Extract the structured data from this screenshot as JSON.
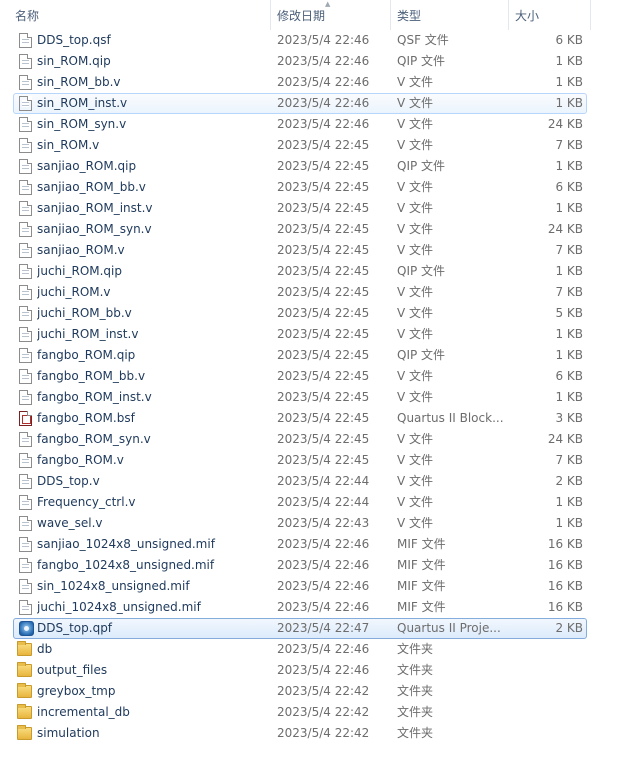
{
  "columns": {
    "name": "名称",
    "date": "修改日期",
    "type": "类型",
    "size": "大小"
  },
  "files": [
    {
      "name": "DDS_top.qsf",
      "date": "2023/5/4 22:46",
      "type": "QSF 文件",
      "size": "6 KB",
      "icon": "document-icon"
    },
    {
      "name": "sin_ROM.qip",
      "date": "2023/5/4 22:46",
      "type": "QIP 文件",
      "size": "1 KB",
      "icon": "document-icon"
    },
    {
      "name": "sin_ROM_bb.v",
      "date": "2023/5/4 22:46",
      "type": "V 文件",
      "size": "1 KB",
      "icon": "document-icon"
    },
    {
      "name": "sin_ROM_inst.v",
      "date": "2023/5/4 22:46",
      "type": "V 文件",
      "size": "1 KB",
      "icon": "document-icon",
      "state": "hover"
    },
    {
      "name": "sin_ROM_syn.v",
      "date": "2023/5/4 22:46",
      "type": "V 文件",
      "size": "24 KB",
      "icon": "document-icon"
    },
    {
      "name": "sin_ROM.v",
      "date": "2023/5/4 22:45",
      "type": "V 文件",
      "size": "7 KB",
      "icon": "document-icon"
    },
    {
      "name": "sanjiao_ROM.qip",
      "date": "2023/5/4 22:45",
      "type": "QIP 文件",
      "size": "1 KB",
      "icon": "document-icon"
    },
    {
      "name": "sanjiao_ROM_bb.v",
      "date": "2023/5/4 22:45",
      "type": "V 文件",
      "size": "6 KB",
      "icon": "document-icon"
    },
    {
      "name": "sanjiao_ROM_inst.v",
      "date": "2023/5/4 22:45",
      "type": "V 文件",
      "size": "1 KB",
      "icon": "document-icon"
    },
    {
      "name": "sanjiao_ROM_syn.v",
      "date": "2023/5/4 22:45",
      "type": "V 文件",
      "size": "24 KB",
      "icon": "document-icon"
    },
    {
      "name": "sanjiao_ROM.v",
      "date": "2023/5/4 22:45",
      "type": "V 文件",
      "size": "7 KB",
      "icon": "document-icon"
    },
    {
      "name": "juchi_ROM.qip",
      "date": "2023/5/4 22:45",
      "type": "QIP 文件",
      "size": "1 KB",
      "icon": "document-icon"
    },
    {
      "name": "juchi_ROM.v",
      "date": "2023/5/4 22:45",
      "type": "V 文件",
      "size": "7 KB",
      "icon": "document-icon"
    },
    {
      "name": "juchi_ROM_bb.v",
      "date": "2023/5/4 22:45",
      "type": "V 文件",
      "size": "5 KB",
      "icon": "document-icon"
    },
    {
      "name": "juchi_ROM_inst.v",
      "date": "2023/5/4 22:45",
      "type": "V 文件",
      "size": "1 KB",
      "icon": "document-icon"
    },
    {
      "name": "fangbo_ROM.qip",
      "date": "2023/5/4 22:45",
      "type": "QIP 文件",
      "size": "1 KB",
      "icon": "document-icon"
    },
    {
      "name": "fangbo_ROM_bb.v",
      "date": "2023/5/4 22:45",
      "type": "V 文件",
      "size": "6 KB",
      "icon": "document-icon"
    },
    {
      "name": "fangbo_ROM_inst.v",
      "date": "2023/5/4 22:45",
      "type": "V 文件",
      "size": "1 KB",
      "icon": "document-icon"
    },
    {
      "name": "fangbo_ROM.bsf",
      "date": "2023/5/4 22:45",
      "type": "Quartus II Block...",
      "size": "3 KB",
      "icon": "block-symbol-icon"
    },
    {
      "name": "fangbo_ROM_syn.v",
      "date": "2023/5/4 22:45",
      "type": "V 文件",
      "size": "24 KB",
      "icon": "document-icon"
    },
    {
      "name": "fangbo_ROM.v",
      "date": "2023/5/4 22:45",
      "type": "V 文件",
      "size": "7 KB",
      "icon": "document-icon"
    },
    {
      "name": "DDS_top.v",
      "date": "2023/5/4 22:44",
      "type": "V 文件",
      "size": "2 KB",
      "icon": "document-icon"
    },
    {
      "name": "Frequency_ctrl.v",
      "date": "2023/5/4 22:44",
      "type": "V 文件",
      "size": "1 KB",
      "icon": "document-icon"
    },
    {
      "name": "wave_sel.v",
      "date": "2023/5/4 22:43",
      "type": "V 文件",
      "size": "1 KB",
      "icon": "document-icon"
    },
    {
      "name": "sanjiao_1024x8_unsigned.mif",
      "date": "2023/5/4 22:46",
      "type": "MIF 文件",
      "size": "16 KB",
      "icon": "document-icon"
    },
    {
      "name": "fangbo_1024x8_unsigned.mif",
      "date": "2023/5/4 22:46",
      "type": "MIF 文件",
      "size": "16 KB",
      "icon": "document-icon"
    },
    {
      "name": "sin_1024x8_unsigned.mif",
      "date": "2023/5/4 22:46",
      "type": "MIF 文件",
      "size": "16 KB",
      "icon": "document-icon"
    },
    {
      "name": "juchi_1024x8_unsigned.mif",
      "date": "2023/5/4 22:46",
      "type": "MIF 文件",
      "size": "16 KB",
      "icon": "document-icon"
    },
    {
      "name": "DDS_top.qpf",
      "date": "2023/5/4 22:47",
      "type": "Quartus II Proje...",
      "size": "2 KB",
      "icon": "quartus-project-icon",
      "state": "selected"
    },
    {
      "name": "db",
      "date": "2023/5/4 22:46",
      "type": "文件夹",
      "size": "",
      "icon": "folder-icon"
    },
    {
      "name": "output_files",
      "date": "2023/5/4 22:46",
      "type": "文件夹",
      "size": "",
      "icon": "folder-icon"
    },
    {
      "name": "greybox_tmp",
      "date": "2023/5/4 22:42",
      "type": "文件夹",
      "size": "",
      "icon": "folder-icon"
    },
    {
      "name": "incremental_db",
      "date": "2023/5/4 22:42",
      "type": "文件夹",
      "size": "",
      "icon": "folder-icon"
    },
    {
      "name": "simulation",
      "date": "2023/5/4 22:42",
      "type": "文件夹",
      "size": "",
      "icon": "folder-icon"
    }
  ]
}
